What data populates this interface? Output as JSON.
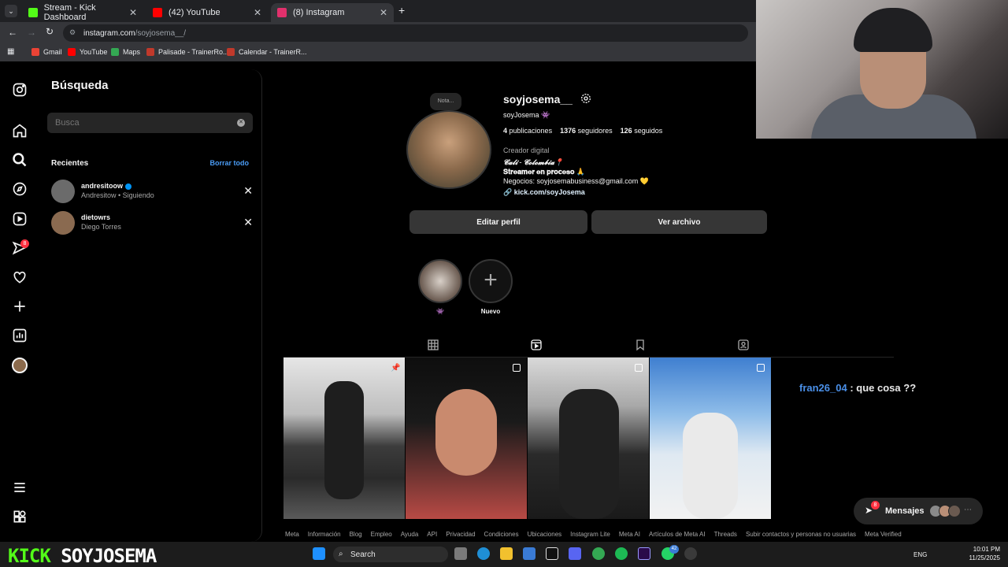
{
  "browser": {
    "tabs": [
      {
        "title": "Stream - Kick Dashboard",
        "color": "#53fc18"
      },
      {
        "title": "(42) YouTube",
        "color": "#ff0000"
      },
      {
        "title": "(8) Instagram",
        "color": "#e1306c"
      }
    ],
    "url_main": "instagram.com",
    "url_path": "/soyjosema__/",
    "bookmarks": [
      "Gmail",
      "YouTube",
      "Maps",
      "Palisade - TrainerRo...",
      "Calendar - TrainerR..."
    ]
  },
  "nav": {
    "notifications_badge": "8"
  },
  "search": {
    "title": "Búsqueda",
    "placeholder": "Busca",
    "recents_label": "Recientes",
    "clear_all": "Borrar todo",
    "recents": [
      {
        "username": "andresitoow",
        "subtitle": "Andresitow • Siguiendo",
        "verified": true,
        "avatar_color": "#6b6b6b"
      },
      {
        "username": "dietowrs",
        "subtitle": "Diego Torres",
        "verified": false,
        "avatar_color": "#8a6a50"
      }
    ]
  },
  "profile": {
    "note": "Nota...",
    "username": "soyjosema__",
    "full_name": "soyJosema 👾",
    "posts_count": "4",
    "posts_label": "publicaciones",
    "followers_count": "1376",
    "followers_label": "seguidores",
    "following_count": "126",
    "following_label": "seguidos",
    "category": "Creador digital",
    "bio_line1": "𝓒𝓪𝓵𝓲 - 𝓒𝓸𝓵𝓸𝓶𝓫𝓲𝓪📍",
    "bio_line2": "𝐒𝐭𝐫𝐞𝐚𝐦𝐞𝐫 𝐞𝐧 𝐩𝐫𝐨𝐜𝐞𝐬𝐨 🙏",
    "bio_line3": "Negocios: soyjosemabusiness@gmail.com 💛",
    "link": "kick.com/soyJosema",
    "edit_button": "Editar perfil",
    "archive_button": "Ver archivo",
    "highlights": [
      {
        "label": "👾"
      },
      {
        "label": "Nuevo"
      }
    ]
  },
  "chat_overlay": {
    "user": "fran26_04",
    "text": ": que cosa ??"
  },
  "messages_bar": {
    "label": "Mensajes",
    "badge": "8"
  },
  "footer_links": [
    "Meta",
    "Información",
    "Blog",
    "Empleo",
    "Ayuda",
    "API",
    "Privacidad",
    "Condiciones",
    "Ubicaciones",
    "Instagram Lite",
    "Meta AI",
    "Artículos de Meta AI",
    "Threads",
    "Subir contactos y personas no usuarias",
    "Meta Verified"
  ],
  "stream_overlay": {
    "brand": "KICK",
    "channel": "SOYJOSEMA"
  },
  "taskbar": {
    "search_label": "Search",
    "language": "ENG",
    "time": "10:01 PM",
    "date": "11/25/2025",
    "whatsapp_badge": "42"
  }
}
